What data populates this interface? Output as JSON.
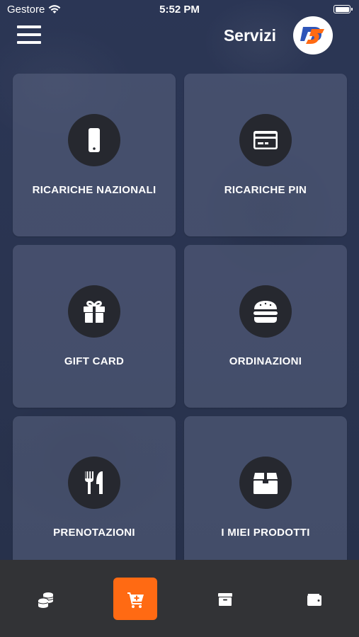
{
  "status_bar": {
    "carrier": "Gestore",
    "time": "5:52 PM"
  },
  "header": {
    "title": "Servizi"
  },
  "services": [
    {
      "label": "RICARICHE NAZIONALI",
      "icon": "mobile-phone-icon"
    },
    {
      "label": "RICARICHE PIN",
      "icon": "credit-card-icon"
    },
    {
      "label": "GIFT CARD",
      "icon": "gift-icon"
    },
    {
      "label": "ORDINAZIONI",
      "icon": "burger-icon"
    },
    {
      "label": "PRENOTAZIONI",
      "icon": "fork-knife-icon"
    },
    {
      "label": "I MIEI PRODOTTI",
      "icon": "box-icon"
    }
  ],
  "tab_bar": {
    "tabs": [
      {
        "icon": "coins-icon",
        "active": false
      },
      {
        "icon": "cart-plus-icon",
        "active": true
      },
      {
        "icon": "archive-icon",
        "active": false
      },
      {
        "icon": "wallet-icon",
        "active": false
      }
    ]
  },
  "colors": {
    "accent": "#ff6a13",
    "card_background": "#56607c",
    "icon_circle": "#26282f",
    "tab_bar": "#323336"
  }
}
